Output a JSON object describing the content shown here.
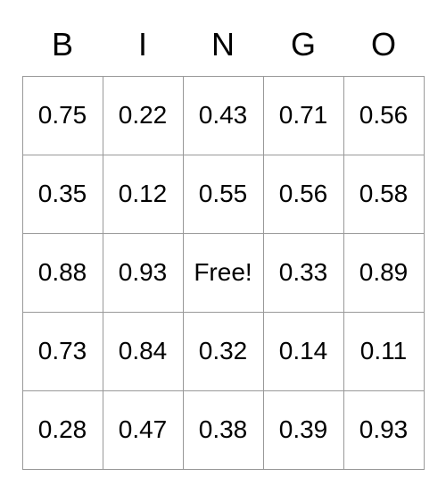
{
  "headers": [
    "B",
    "I",
    "N",
    "G",
    "O"
  ],
  "grid": [
    [
      "0.75",
      "0.22",
      "0.43",
      "0.71",
      "0.56"
    ],
    [
      "0.35",
      "0.12",
      "0.55",
      "0.56",
      "0.58"
    ],
    [
      "0.88",
      "0.93",
      "Free!",
      "0.33",
      "0.89"
    ],
    [
      "0.73",
      "0.84",
      "0.32",
      "0.14",
      "0.11"
    ],
    [
      "0.28",
      "0.47",
      "0.38",
      "0.39",
      "0.93"
    ]
  ]
}
